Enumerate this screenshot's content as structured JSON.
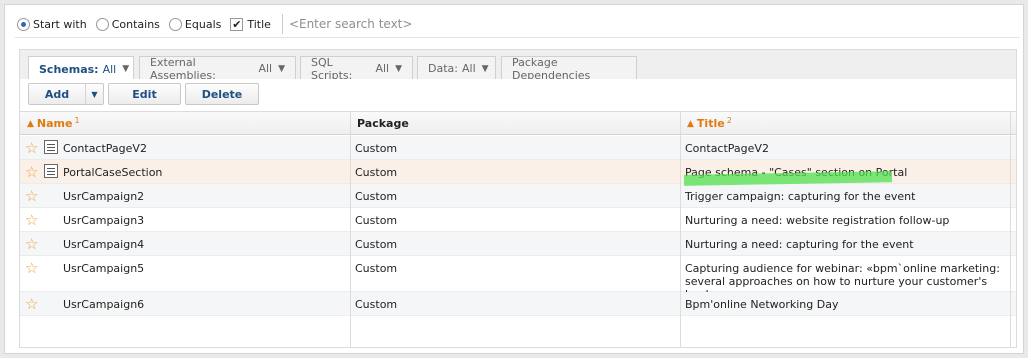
{
  "search": {
    "options": [
      {
        "label": "Start with",
        "selected": true
      },
      {
        "label": "Contains",
        "selected": false
      },
      {
        "label": "Equals",
        "selected": false
      }
    ],
    "title_checkbox": {
      "label": "Title",
      "checked": true
    },
    "placeholder": "<Enter search text>"
  },
  "tabs": [
    {
      "label": "Schemas:",
      "value": "All",
      "active": true
    },
    {
      "label": "External Assemblies:",
      "value": "All",
      "active": false
    },
    {
      "label": "SQL Scripts:",
      "value": "All",
      "active": false
    },
    {
      "label": "Data:",
      "value": "All",
      "active": false
    },
    {
      "label": "Package Dependencies",
      "value": "",
      "active": false
    }
  ],
  "toolbar": {
    "add_label": "Add",
    "edit_label": "Edit",
    "delete_label": "Delete"
  },
  "grid": {
    "columns": [
      {
        "label": "Name",
        "sort_order": "1"
      },
      {
        "label": "Package",
        "sort_order": ""
      },
      {
        "label": "Title",
        "sort_order": "2"
      }
    ],
    "rows": [
      {
        "name": "ContactPageV2",
        "package": "Custom",
        "title": "ContactPageV2",
        "has_doc_icon": true
      },
      {
        "name": "PortalCaseSection",
        "package": "Custom",
        "title": "Page schema - \"Cases\" section on Portal",
        "has_doc_icon": true
      },
      {
        "name": "UsrCampaign2",
        "package": "Custom",
        "title": "Trigger campaign: capturing for the event",
        "has_doc_icon": false
      },
      {
        "name": "UsrCampaign3",
        "package": "Custom",
        "title": "Nurturing a need: website registration follow-up",
        "has_doc_icon": false
      },
      {
        "name": "UsrCampaign4",
        "package": "Custom",
        "title": "Nurturing a need: capturing for the event",
        "has_doc_icon": false
      },
      {
        "name": "UsrCampaign5",
        "package": "Custom",
        "title": "Capturing audience for webinar: «bpm`online marketing: several approaches on how to nurture your customer's leads»",
        "has_doc_icon": false
      },
      {
        "name": "UsrCampaign6",
        "package": "Custom",
        "title": "Bpm'online Networking Day",
        "has_doc_icon": false
      }
    ]
  },
  "colors": {
    "accent": "#1f4f82",
    "sort_accent": "#e07b12",
    "star": "#e8a63c",
    "highlight": "#4fe04f"
  }
}
